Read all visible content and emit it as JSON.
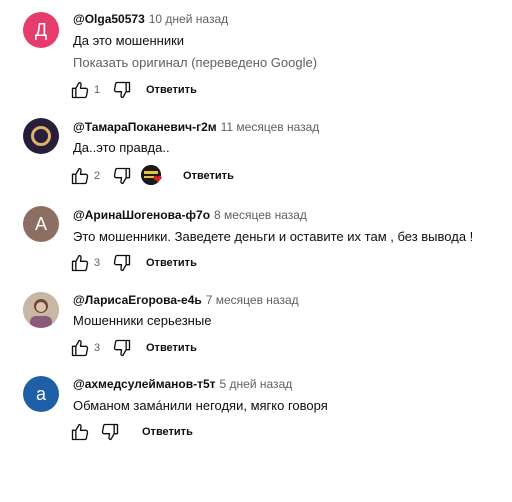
{
  "comments": [
    {
      "avatar": {
        "letter": "Д",
        "color": "#e53c6b"
      },
      "author": "@Olga50573",
      "time": "10 дней назад",
      "text": "Да это мошенники",
      "translate": "Показать оригинал (переведено Google)",
      "likes": "1",
      "reply": "Ответить"
    },
    {
      "avatar": {
        "letter": "",
        "color": "#2a1d3a",
        "ring": "#d9b46a"
      },
      "author": "@ТамараПоканевич-г2м",
      "time": "11 месяцев назад",
      "text": "Да..это правда..",
      "likes": "2",
      "reply": "Ответить",
      "creator_heart": true
    },
    {
      "avatar": {
        "letter": "А",
        "color": "#8d6e63"
      },
      "author": "@АринаШогенова-ф7о",
      "time": "8 месяцев назад",
      "text": "Это мошенники. Заведете деньги и оставите их там , без вывода !",
      "likes": "3",
      "reply": "Ответить"
    },
    {
      "avatar": {
        "letter": "",
        "color": "#b9a28e"
      },
      "author": "@ЛарисаЕгорова-е4ь",
      "time": "7 месяцев назад",
      "text": "Мошенники серьезные",
      "likes": "3",
      "reply": "Ответить"
    },
    {
      "avatar": {
        "letter": "а",
        "color": "#1f5fa8"
      },
      "author": "@ахмедсулейманов-т5т",
      "time": "5 дней назад",
      "text": "Обманом замáнили негодяи, мягко говоря",
      "likes": "",
      "reply": "Ответить"
    }
  ]
}
